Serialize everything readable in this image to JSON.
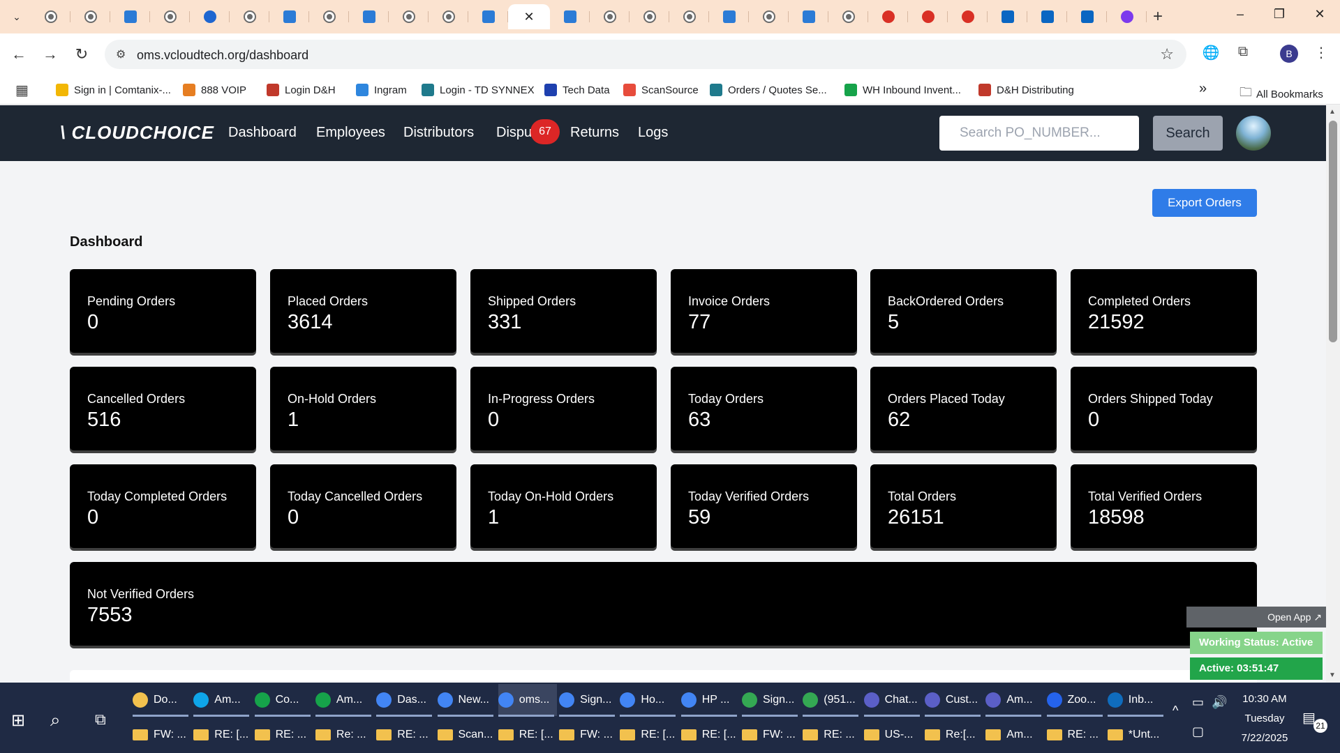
{
  "browser": {
    "url": "oms.vcloudtech.org/dashboard",
    "new_tab_glyph": "+",
    "controls": {
      "minimize": "–",
      "restore": "❐",
      "close": "✕"
    },
    "profile_initial": "B",
    "tab_glyphs": {
      "active_close": "✕"
    }
  },
  "bookmarks": [
    {
      "label": "Sign in | Comtanix-...",
      "color": "#f2b705"
    },
    {
      "label": "888 VOIP",
      "color": "#e67e22"
    },
    {
      "label": "Login D&H",
      "color": "#c0392b"
    },
    {
      "label": "Ingram",
      "color": "#2e86de"
    },
    {
      "label": "Login - TD SYNNEX",
      "color": "#1f7a8c"
    },
    {
      "label": "Tech Data",
      "color": "#1e40af"
    },
    {
      "label": "ScanSource",
      "color": "#e74c3c"
    },
    {
      "label": "Orders / Quotes Se...",
      "color": "#1f7a8c"
    },
    {
      "label": "WH Inbound Invent...",
      "color": "#16a34a"
    },
    {
      "label": "D&H Distributing",
      "color": "#c0392b"
    }
  ],
  "bookmarks_more": "»",
  "all_bookmarks": "All Bookmarks",
  "app": {
    "logo": "\\ CLOUDCHOICE",
    "nav": [
      "Dashboard",
      "Employees",
      "Distributors",
      "Dispu",
      "Returns",
      "Logs"
    ],
    "disputes_badge": "67",
    "search_placeholder": "Search PO_NUMBER...",
    "search_button": "Search",
    "export_button": "Export Orders",
    "page_title": "Dashboard"
  },
  "cards": [
    {
      "label": "Pending Orders",
      "value": "0"
    },
    {
      "label": "Placed Orders",
      "value": "3614"
    },
    {
      "label": "Shipped Orders",
      "value": "331"
    },
    {
      "label": "Invoice Orders",
      "value": "77"
    },
    {
      "label": "BackOrdered Orders",
      "value": "5"
    },
    {
      "label": "Completed Orders",
      "value": "21592"
    },
    {
      "label": "Cancelled Orders",
      "value": "516"
    },
    {
      "label": "On-Hold Orders",
      "value": "1"
    },
    {
      "label": "In-Progress Orders",
      "value": "0"
    },
    {
      "label": "Today Orders",
      "value": "63"
    },
    {
      "label": "Orders Placed Today",
      "value": "62"
    },
    {
      "label": "Orders Shipped Today",
      "value": "0"
    },
    {
      "label": "Today Completed Orders",
      "value": "0"
    },
    {
      "label": "Today Cancelled Orders",
      "value": "0"
    },
    {
      "label": "Today On-Hold Orders",
      "value": "1"
    },
    {
      "label": "Today Verified Orders",
      "value": "59"
    },
    {
      "label": "Total Orders",
      "value": "26151"
    },
    {
      "label": "Total Verified Orders",
      "value": "18598"
    },
    {
      "label": "Not Verified Orders",
      "value": "7553"
    }
  ],
  "widget": {
    "open_app": "Open App ↗",
    "working_status": "Working Status: Active",
    "active_time": "Active: 03:51:47"
  },
  "taskbar": {
    "row1": [
      {
        "label": "Do...",
        "color": "#f2c14e"
      },
      {
        "label": "Am...",
        "color": "#0ea5e9"
      },
      {
        "label": "Co...",
        "color": "#16a34a"
      },
      {
        "label": "Am...",
        "color": "#16a34a"
      },
      {
        "label": "Das...",
        "color": "#4285f4"
      },
      {
        "label": "New...",
        "color": "#4285f4"
      },
      {
        "label": "oms...",
        "color": "#4285f4"
      },
      {
        "label": "Sign...",
        "color": "#4285f4"
      },
      {
        "label": "Ho...",
        "color": "#4285f4"
      },
      {
        "label": "HP ...",
        "color": "#4285f4"
      },
      {
        "label": "Sign...",
        "color": "#34a853"
      },
      {
        "label": "(951...",
        "color": "#34a853"
      },
      {
        "label": "Chat...",
        "color": "#5b5fc7"
      },
      {
        "label": "Cust...",
        "color": "#5b5fc7"
      },
      {
        "label": "Am...",
        "color": "#5b5fc7"
      },
      {
        "label": "Zoo...",
        "color": "#2563eb"
      },
      {
        "label": "Inb...",
        "color": "#0f6cbd"
      }
    ],
    "row2": [
      "FW: ...",
      "RE: [...",
      "RE: ...",
      "Re: ...",
      "RE: ...",
      "Scan...",
      "RE: [...",
      "FW: ...",
      "RE: [...",
      "RE: [...",
      "FW: ...",
      "RE: ...",
      "US-...",
      "Re:[...",
      "Am...",
      "RE: ...",
      "*Unt..."
    ],
    "time": "10:30 AM",
    "day": "Tuesday",
    "date": "7/22/2025",
    "notifications": "21"
  }
}
